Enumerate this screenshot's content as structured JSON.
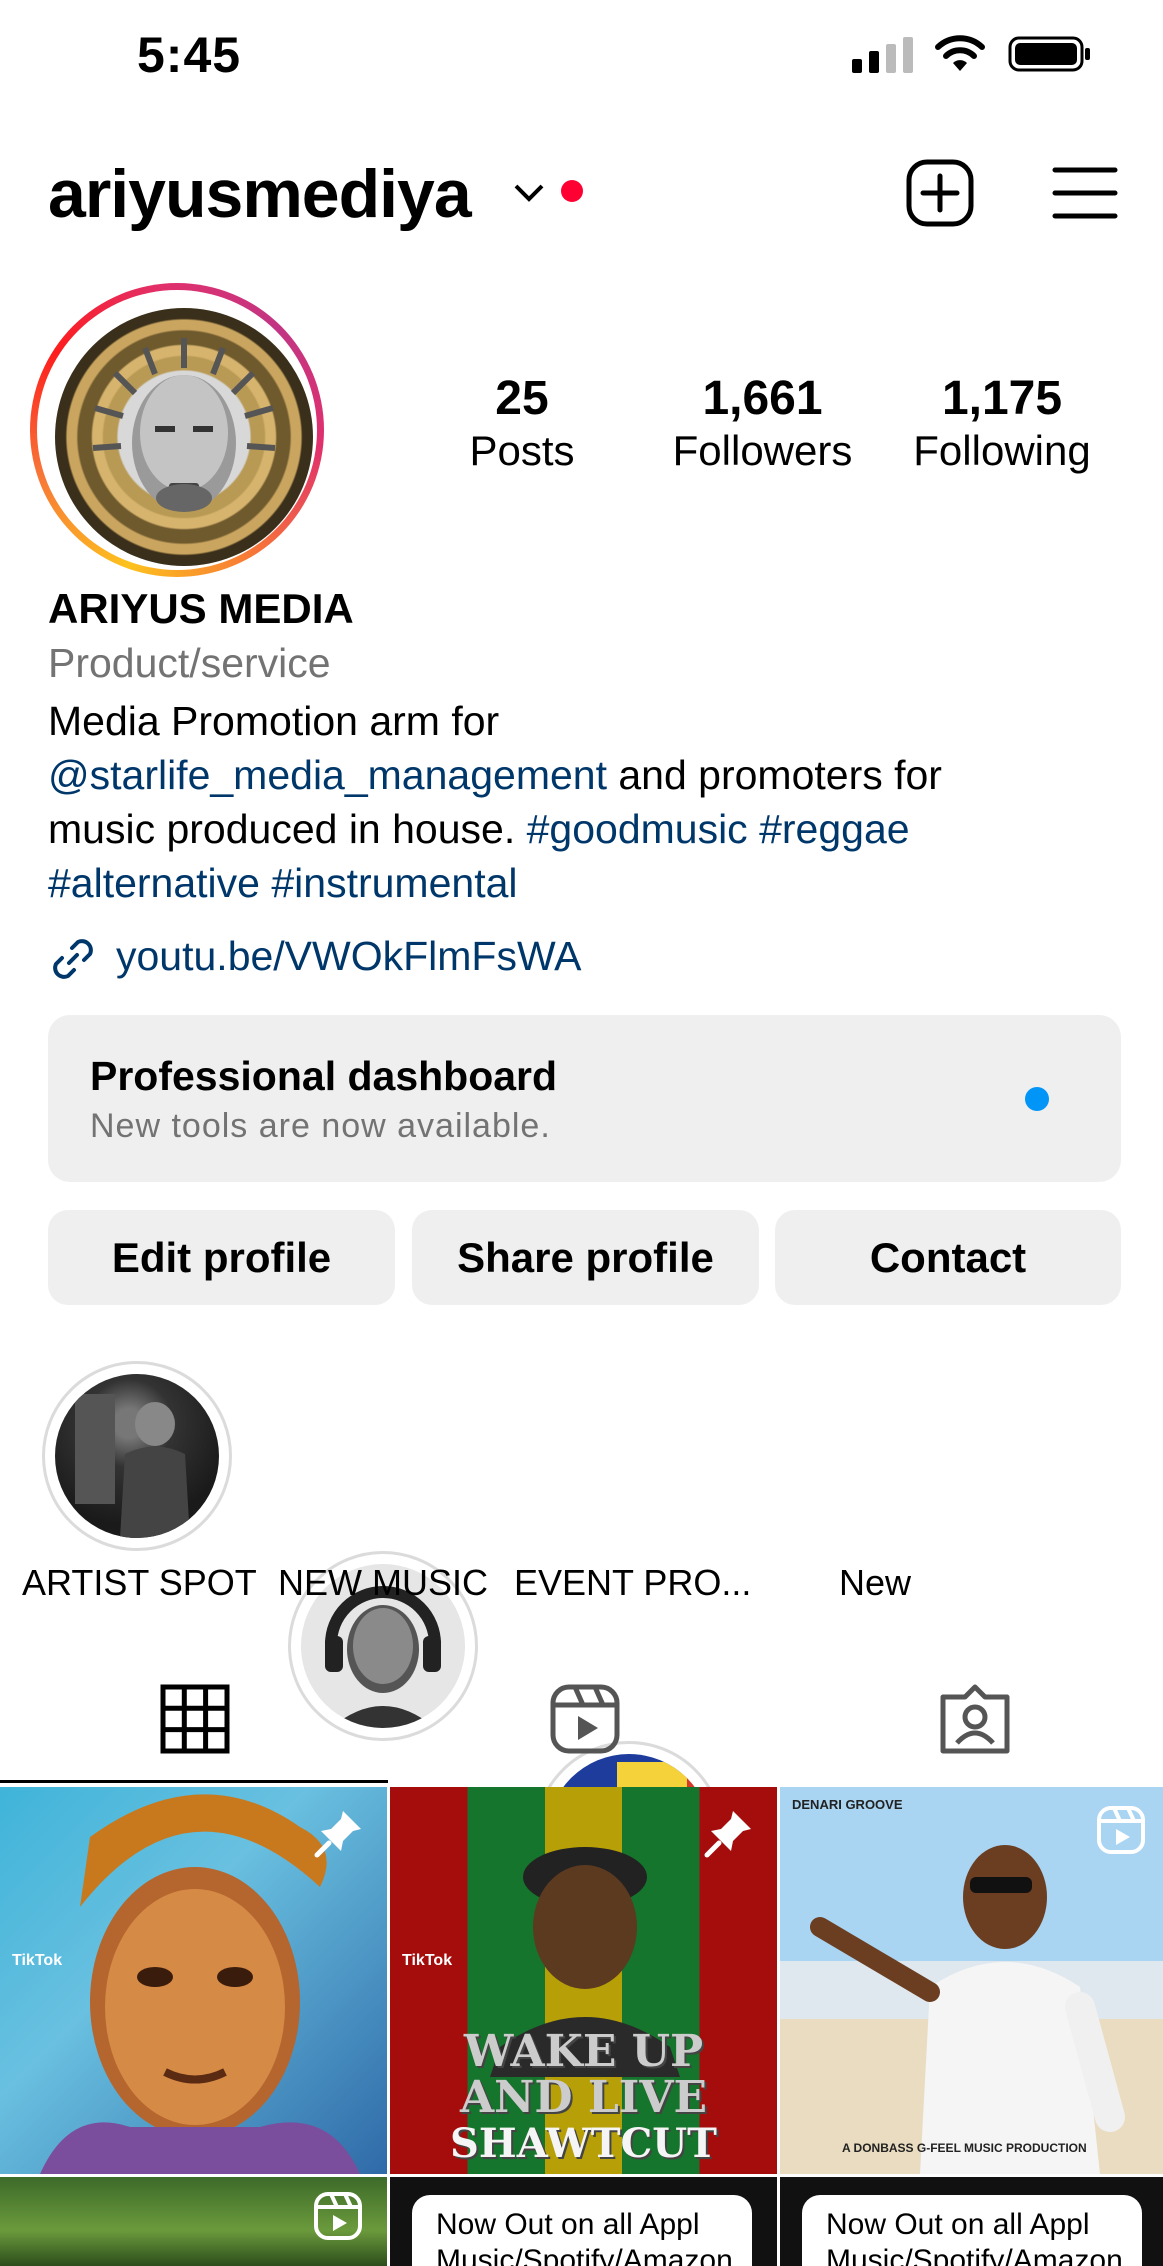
{
  "status_bar": {
    "time": "5:45"
  },
  "header": {
    "username": "ariyusmediya",
    "chevron_icon": "chevron-down-icon",
    "new_post_icon": "plus-square-icon",
    "menu_icon": "hamburger-menu-icon"
  },
  "stats": [
    {
      "value": "25",
      "label": "Posts"
    },
    {
      "value": "1,661",
      "label": "Followers"
    },
    {
      "value": "1,175",
      "label": "Following"
    }
  ],
  "bio": {
    "name": "ARIYUS MEDIA",
    "category": "Product/service",
    "line1": "Media Promotion arm for",
    "mention": "@starlife_media_management",
    "after_mention": " and promoters for",
    "line3_text": "music produced in house. ",
    "hashtag_goodmusic": "#goodmusic",
    "hashtag_reggae": "#reggae",
    "hashtag_alternative": "#alternative",
    "hashtag_instrumental": "#instrumental",
    "link": "youtu.be/VWOkFlmFsWA"
  },
  "dashboard": {
    "title": "Professional dashboard",
    "subtitle": "New tools are now available."
  },
  "buttons": {
    "edit": "Edit profile",
    "share": "Share profile",
    "contact": "Contact"
  },
  "highlights": [
    {
      "label": "ARTIST SPOT"
    },
    {
      "label": "NEW MUSIC"
    },
    {
      "label": "EVENT PRO..."
    },
    {
      "label": "New"
    }
  ],
  "tabs": {
    "grid_icon": "grid-icon",
    "reels_icon": "reels-icon",
    "tagged_icon": "tagged-icon"
  },
  "grid": {
    "post2_text_line1": "WAKE UP",
    "post2_text_line2": "AND LIVE",
    "post2_text_line3": "SHAWTCUT",
    "post3_header": "DENARI GROOVE",
    "post3_footer": "A DONBASS  G-FEEL MUSIC PRODUCTION",
    "post5_text": "Now Out on all Appl",
    "post5_text2": "Music/Spotify/Amazon",
    "post6_text": "Now Out on all Appl",
    "post6_text2": "Music/Spotify/Amazon",
    "tiktok_label": "TikTok"
  }
}
